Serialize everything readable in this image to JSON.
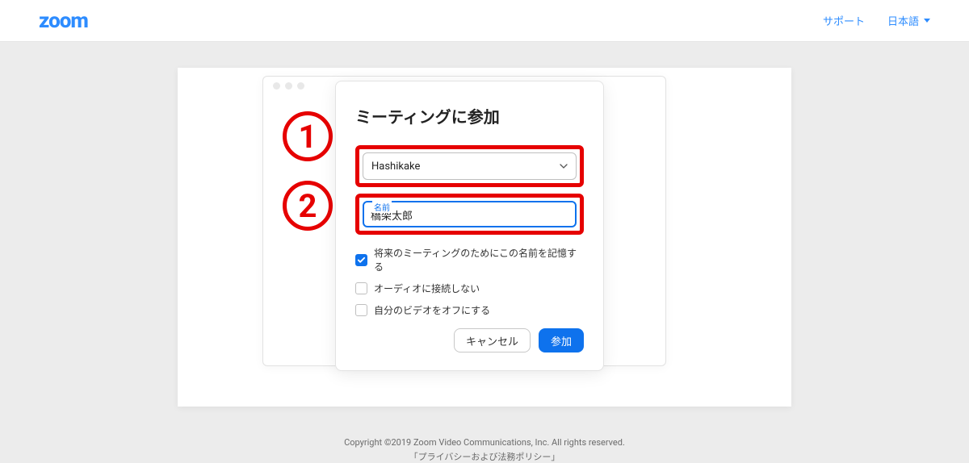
{
  "header": {
    "logo": "zoom",
    "support_link": "サポート",
    "language_label": "日本語"
  },
  "dialog": {
    "title": "ミーティングに参加",
    "meeting_id_value": "Hashikake",
    "name_field_label": "名前",
    "name_field_value": "橋架太郎",
    "remember_name_label": "将来のミーティングのためにこの名前を記憶する",
    "no_audio_label": "オーディオに接続しない",
    "video_off_label": "自分のビデオをオフにする",
    "cancel_label": "キャンセル",
    "join_label": "参加"
  },
  "annotations": {
    "badge1": "1",
    "badge2": "2"
  },
  "footer": {
    "copyright": "Copyright ©2019 Zoom Video Communications, Inc. All rights reserved.",
    "privacy": "「プライバシーおよび法務ポリシー」"
  },
  "colors": {
    "brand_blue": "#2d8cff",
    "action_blue": "#0e72ed",
    "annotation_red": "#e60000"
  }
}
